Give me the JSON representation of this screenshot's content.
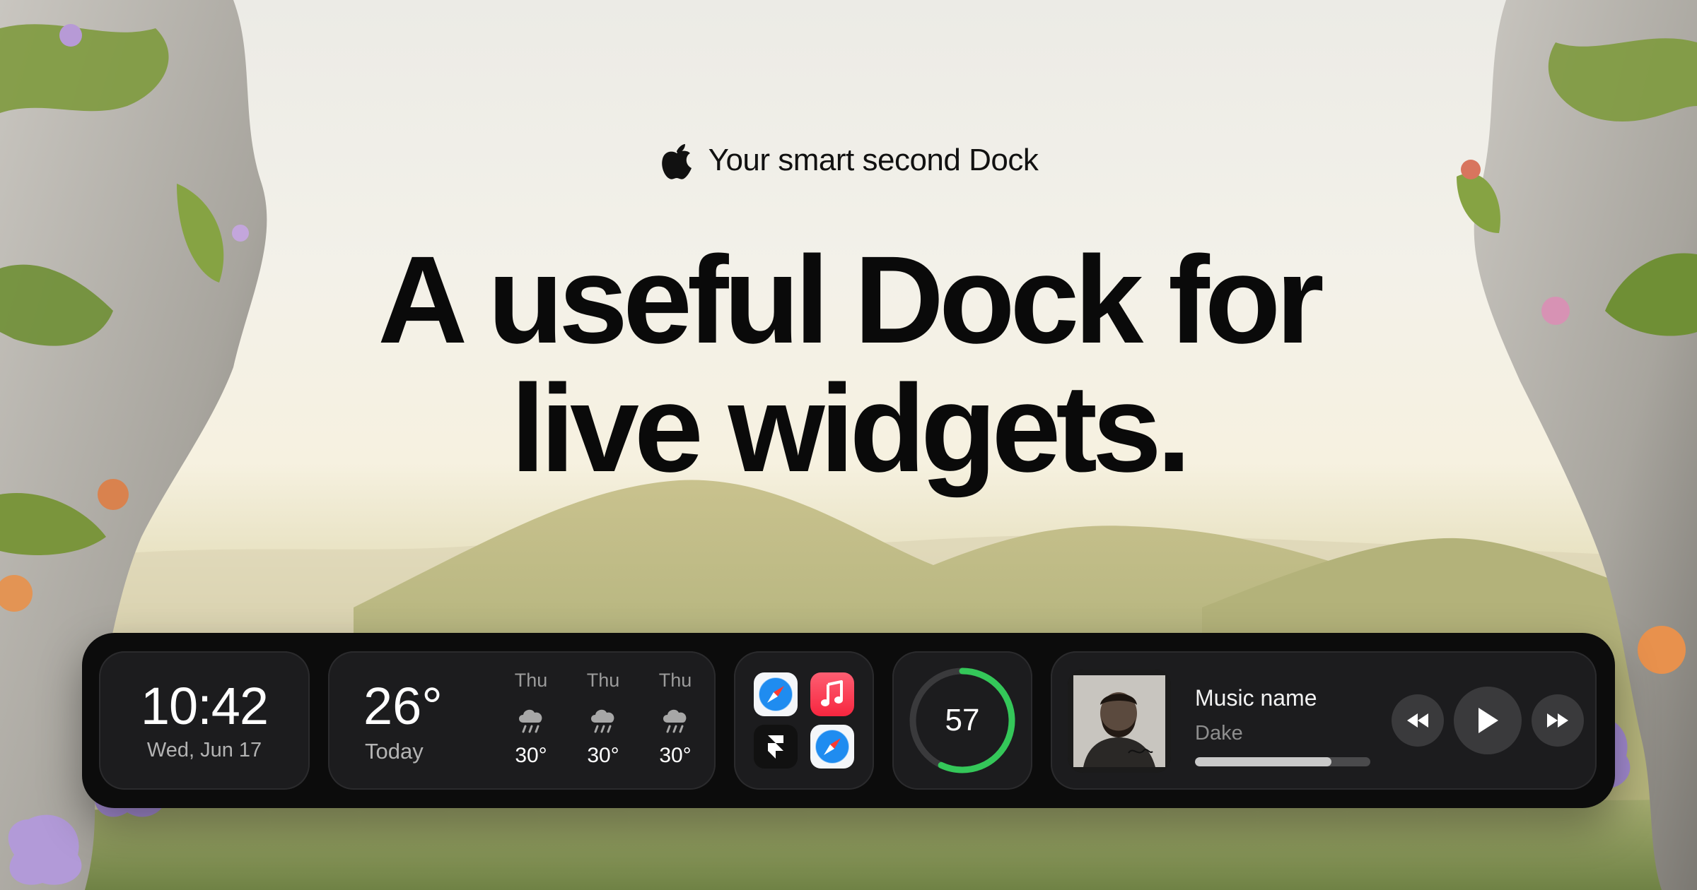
{
  "hero": {
    "tagline": "Your smart second Dock",
    "headline_line1": "A useful Dock for",
    "headline_line2": "live widgets."
  },
  "clock": {
    "time": "10:42",
    "date": "Wed, Jun 17"
  },
  "weather": {
    "temp": "26°",
    "label": "Today",
    "forecast": [
      {
        "day": "Thu",
        "icon": "rain-cloud-icon",
        "temp": "30°"
      },
      {
        "day": "Thu",
        "icon": "rain-cloud-icon",
        "temp": "30°"
      },
      {
        "day": "Thu",
        "icon": "rain-cloud-icon",
        "temp": "30°"
      }
    ]
  },
  "apps": [
    {
      "name": "safari-app-icon"
    },
    {
      "name": "music-app-icon"
    },
    {
      "name": "framer-app-icon"
    },
    {
      "name": "safari-app-icon"
    }
  ],
  "ring": {
    "value": "57",
    "progress": 0.57,
    "color": "#34c759"
  },
  "music": {
    "title": "Music name",
    "artist": "Dake",
    "progress": 0.78,
    "controls": [
      "rewind-icon",
      "play-icon",
      "fast-forward-icon"
    ]
  },
  "colors": {
    "dock": "#0c0c0c",
    "widget": "#1c1c1e",
    "accent_green": "#34c759"
  }
}
